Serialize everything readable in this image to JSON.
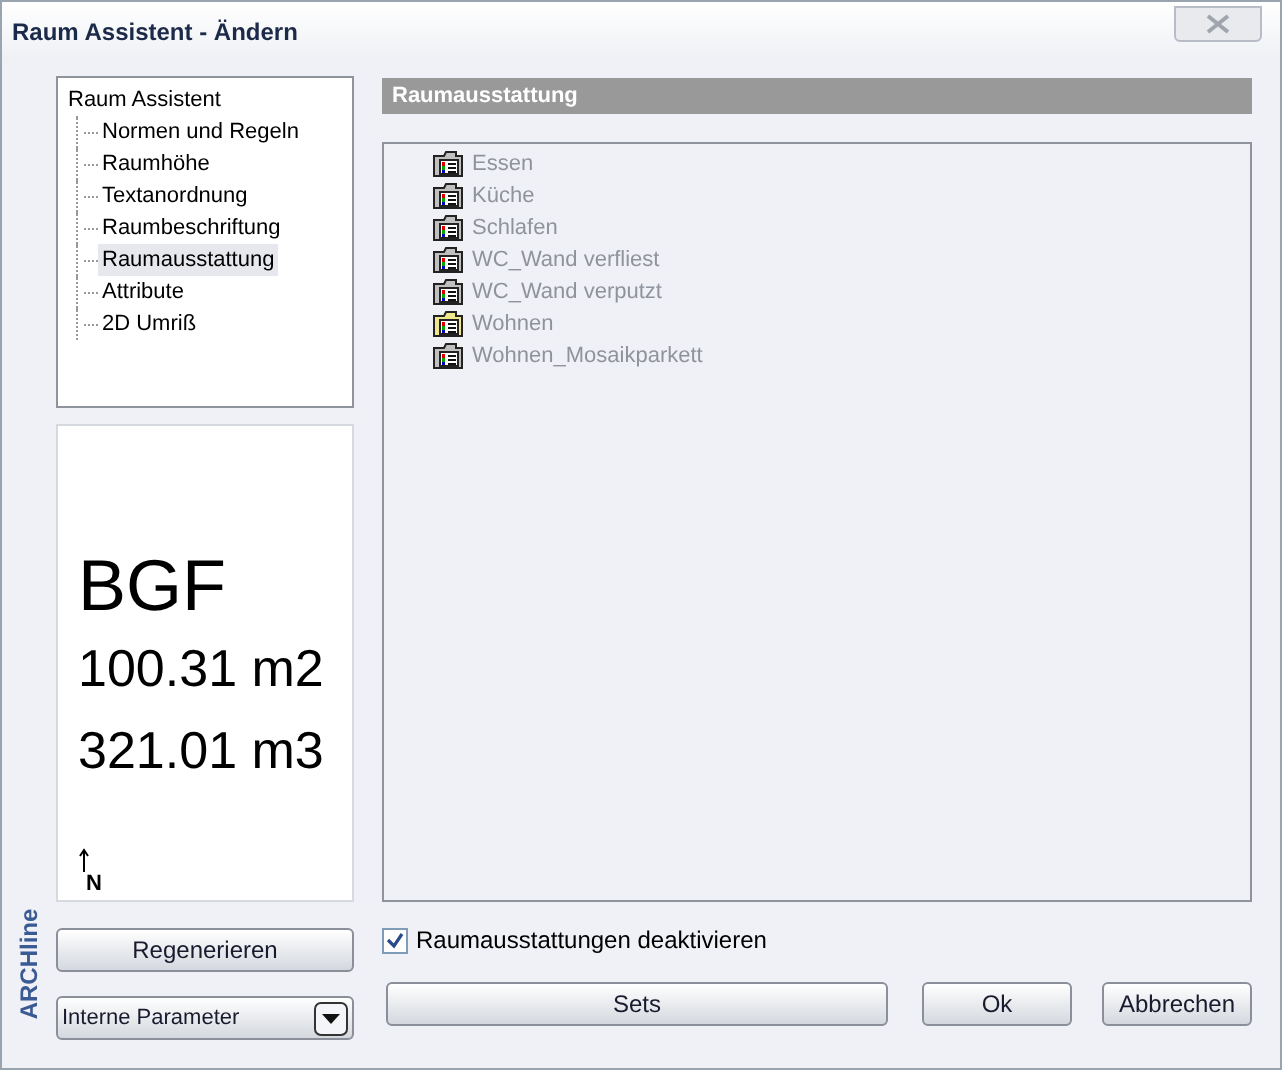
{
  "window": {
    "title": "Raum Assistent - Ändern"
  },
  "tree": {
    "label": "Raum Assistent",
    "children": [
      {
        "label": "Normen und Regeln",
        "selected": false
      },
      {
        "label": "Raumhöhe",
        "selected": false
      },
      {
        "label": "Textanordnung",
        "selected": false
      },
      {
        "label": "Raumbeschriftung",
        "selected": false
      },
      {
        "label": "Raumausstattung",
        "selected": true
      },
      {
        "label": "Attribute",
        "selected": false
      },
      {
        "label": "2D Umriß",
        "selected": false
      }
    ]
  },
  "preview": {
    "lines": [
      "BGF",
      "100.31 m2",
      "321.01 m3"
    ],
    "north": "N"
  },
  "side_label": "ARCHline",
  "regenerate_button": "Regenerieren",
  "parameter_select": {
    "value": "Interne Parameter"
  },
  "section": {
    "title": "Raumausstattung",
    "disabled": true,
    "items": [
      {
        "label": "Essen",
        "color": "#c0c0c0"
      },
      {
        "label": "Küche",
        "color": "#c0c0c0"
      },
      {
        "label": "Schlafen",
        "color": "#c0c0c0"
      },
      {
        "label": "WC_Wand verfliest",
        "color": "#c0c0c0"
      },
      {
        "label": "WC_Wand verputzt",
        "color": "#c0c0c0"
      },
      {
        "label": "Wohnen",
        "color": "#f0e68c"
      },
      {
        "label": "Wohnen_Mosaikparkett",
        "color": "#c0c0c0"
      }
    ]
  },
  "deactivate_checkbox": {
    "label": "Raumausstattungen deaktivieren",
    "checked": true
  },
  "buttons": {
    "sets": "Sets",
    "ok": "Ok",
    "cancel": "Abbrechen"
  }
}
